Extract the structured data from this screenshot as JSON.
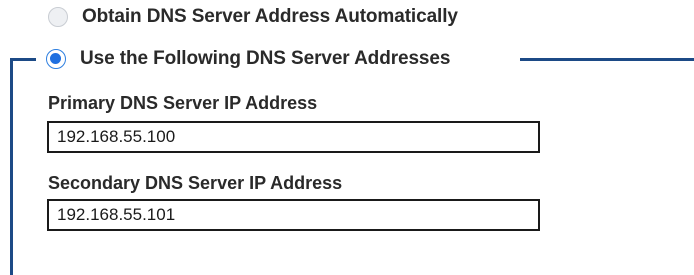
{
  "dns": {
    "auto_option_label": "Obtain DNS Server Address Automatically",
    "auto_option_selected": false,
    "manual_option_label": "Use the Following DNS Server Addresses",
    "manual_option_selected": true,
    "primary_label": "Primary DNS Server IP Address",
    "primary_value": "192.168.55.100",
    "secondary_label": "Secondary DNS Server IP Address",
    "secondary_value": "192.168.55.101"
  },
  "colors": {
    "accent": "#1e6fe0",
    "group_border": "#1c4a86"
  }
}
